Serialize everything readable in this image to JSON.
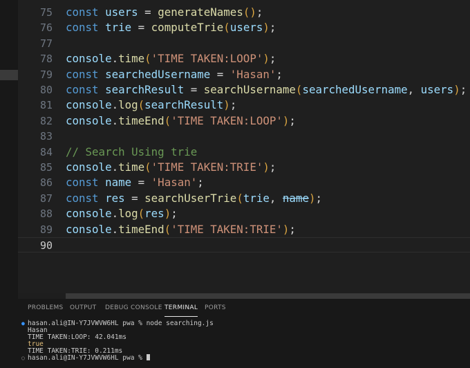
{
  "editor": {
    "lines": [
      {
        "num": "75",
        "tokens": [
          {
            "c": "kw",
            "t": "const"
          },
          {
            "c": "pn",
            "t": " "
          },
          {
            "c": "vr",
            "t": "users"
          },
          {
            "c": "pn",
            "t": " = "
          },
          {
            "c": "fn",
            "t": "generateNames"
          },
          {
            "c": "pr",
            "t": "()"
          },
          {
            "c": "pn",
            "t": ";"
          }
        ]
      },
      {
        "num": "76",
        "tokens": [
          {
            "c": "kw",
            "t": "const"
          },
          {
            "c": "pn",
            "t": " "
          },
          {
            "c": "vr",
            "t": "trie"
          },
          {
            "c": "pn",
            "t": " = "
          },
          {
            "c": "fn",
            "t": "computeTrie"
          },
          {
            "c": "pr",
            "t": "("
          },
          {
            "c": "vr",
            "t": "users"
          },
          {
            "c": "pr",
            "t": ")"
          },
          {
            "c": "pn",
            "t": ";"
          }
        ]
      },
      {
        "num": "77",
        "tokens": []
      },
      {
        "num": "78",
        "tokens": [
          {
            "c": "vr",
            "t": "console"
          },
          {
            "c": "pn",
            "t": "."
          },
          {
            "c": "fn",
            "t": "time"
          },
          {
            "c": "pr",
            "t": "("
          },
          {
            "c": "st",
            "t": "'TIME TAKEN:LOOP'"
          },
          {
            "c": "pr",
            "t": ")"
          },
          {
            "c": "pn",
            "t": ";"
          }
        ]
      },
      {
        "num": "79",
        "tokens": [
          {
            "c": "kw",
            "t": "const"
          },
          {
            "c": "pn",
            "t": " "
          },
          {
            "c": "vr",
            "t": "searchedUsername"
          },
          {
            "c": "pn",
            "t": " = "
          },
          {
            "c": "st",
            "t": "'Hasan'"
          },
          {
            "c": "pn",
            "t": ";"
          }
        ]
      },
      {
        "num": "80",
        "tokens": [
          {
            "c": "kw",
            "t": "const"
          },
          {
            "c": "pn",
            "t": " "
          },
          {
            "c": "vr",
            "t": "searchResult"
          },
          {
            "c": "pn",
            "t": " = "
          },
          {
            "c": "fn",
            "t": "searchUsername"
          },
          {
            "c": "pr",
            "t": "("
          },
          {
            "c": "vr",
            "t": "searchedUsername"
          },
          {
            "c": "pn",
            "t": ", "
          },
          {
            "c": "vr",
            "t": "users"
          },
          {
            "c": "pr",
            "t": ")"
          },
          {
            "c": "pn",
            "t": ";"
          }
        ]
      },
      {
        "num": "81",
        "tokens": [
          {
            "c": "vr",
            "t": "console"
          },
          {
            "c": "pn",
            "t": "."
          },
          {
            "c": "fn",
            "t": "log"
          },
          {
            "c": "pr",
            "t": "("
          },
          {
            "c": "vr",
            "t": "searchResult"
          },
          {
            "c": "pr",
            "t": ")"
          },
          {
            "c": "pn",
            "t": ";"
          }
        ]
      },
      {
        "num": "82",
        "tokens": [
          {
            "c": "vr",
            "t": "console"
          },
          {
            "c": "pn",
            "t": "."
          },
          {
            "c": "fn",
            "t": "timeEnd"
          },
          {
            "c": "pr",
            "t": "("
          },
          {
            "c": "st",
            "t": "'TIME TAKEN:LOOP'"
          },
          {
            "c": "pr",
            "t": ")"
          },
          {
            "c": "pn",
            "t": ";"
          }
        ]
      },
      {
        "num": "83",
        "tokens": []
      },
      {
        "num": "84",
        "tokens": [
          {
            "c": "cm",
            "t": "// Search Using trie"
          }
        ]
      },
      {
        "num": "85",
        "tokens": [
          {
            "c": "vr",
            "t": "console"
          },
          {
            "c": "pn",
            "t": "."
          },
          {
            "c": "fn",
            "t": "time"
          },
          {
            "c": "pr",
            "t": "("
          },
          {
            "c": "st",
            "t": "'TIME TAKEN:TRIE'"
          },
          {
            "c": "pr",
            "t": ")"
          },
          {
            "c": "pn",
            "t": ";"
          }
        ]
      },
      {
        "num": "86",
        "tokens": [
          {
            "c": "kw",
            "t": "const"
          },
          {
            "c": "pn",
            "t": " "
          },
          {
            "c": "vr",
            "t": "name"
          },
          {
            "c": "pn",
            "t": " = "
          },
          {
            "c": "st",
            "t": "'Hasan'"
          },
          {
            "c": "pn",
            "t": ";"
          }
        ]
      },
      {
        "num": "87",
        "tokens": [
          {
            "c": "kw",
            "t": "const"
          },
          {
            "c": "pn",
            "t": " "
          },
          {
            "c": "vr",
            "t": "res"
          },
          {
            "c": "pn",
            "t": " = "
          },
          {
            "c": "fn",
            "t": "searchUserTrie"
          },
          {
            "c": "pr",
            "t": "("
          },
          {
            "c": "vr",
            "t": "trie"
          },
          {
            "c": "pn",
            "t": ", "
          },
          {
            "c": "strike",
            "t": "name"
          },
          {
            "c": "pr",
            "t": ")"
          },
          {
            "c": "pn",
            "t": ";"
          }
        ]
      },
      {
        "num": "88",
        "tokens": [
          {
            "c": "vr",
            "t": "console"
          },
          {
            "c": "pn",
            "t": "."
          },
          {
            "c": "fn",
            "t": "log"
          },
          {
            "c": "pr",
            "t": "("
          },
          {
            "c": "vr",
            "t": "res"
          },
          {
            "c": "pr",
            "t": ")"
          },
          {
            "c": "pn",
            "t": ";"
          }
        ]
      },
      {
        "num": "89",
        "tokens": [
          {
            "c": "vr",
            "t": "console"
          },
          {
            "c": "pn",
            "t": "."
          },
          {
            "c": "fn",
            "t": "timeEnd"
          },
          {
            "c": "pr",
            "t": "("
          },
          {
            "c": "st",
            "t": "'TIME TAKEN:TRIE'"
          },
          {
            "c": "pr",
            "t": ")"
          },
          {
            "c": "pn",
            "t": ";"
          }
        ]
      },
      {
        "num": "90",
        "tokens": [],
        "current": true
      }
    ]
  },
  "panel": {
    "tabs": {
      "problems": "PROBLEMS",
      "output": "OUTPUT",
      "debug_console": "DEBUG CONSOLE",
      "terminal": "TERMINAL",
      "ports": "PORTS"
    },
    "terminal": {
      "prompt_1": "hasan.ali@IN-Y7JVWVW6HL pwa % node searching.js",
      "out_1": "Hasan",
      "out_2": "TIME TAKEN:LOOP: 42.041ms",
      "out_3": "true",
      "out_4": "TIME TAKEN:TRIE: 0.211ms",
      "prompt_2": "hasan.ali@IN-Y7JVWVW6HL pwa % "
    }
  },
  "colors": {
    "keyword": "#569cd6",
    "variable": "#9cdcfe",
    "function": "#dcdcaa",
    "string": "#ce9178",
    "comment": "#6a9955",
    "status_blue": "#3794ff"
  }
}
